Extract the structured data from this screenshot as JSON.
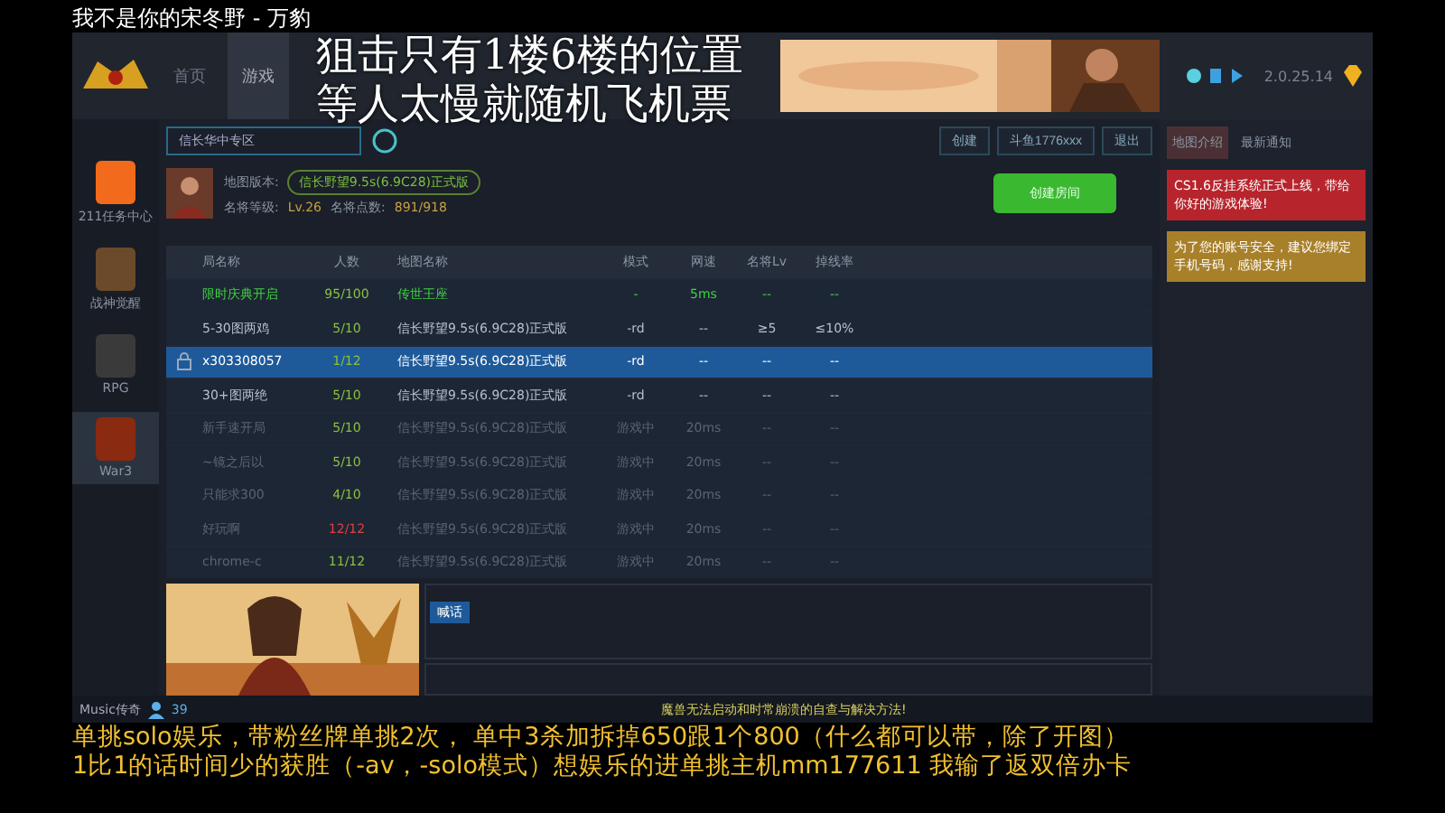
{
  "stream_title": "我不是你的宋冬野 - 万豹",
  "overlay_text": [
    "狙击只有1楼6楼的位置",
    "等人太慢就随机飞机票"
  ],
  "header": {
    "nav": [
      {
        "label": "首页",
        "selected": false
      },
      {
        "label": "游戏",
        "selected": true
      }
    ],
    "version": "2.0.25.14"
  },
  "sidebar": {
    "items": [
      {
        "label": "211任务中心",
        "selected": false
      },
      {
        "label": "战神觉醒",
        "selected": false
      },
      {
        "label": "RPG",
        "selected": false
      },
      {
        "label": "War3",
        "selected": true
      }
    ]
  },
  "lobby": {
    "zone": "信长华中专区",
    "map_label": "地图版本:",
    "map_value": "信长野望9.5s(6.9C28)正式版",
    "level_label": "名将等级:",
    "level": "Lv.26",
    "points_label": "名将点数:",
    "points": "891/918",
    "top_buttons": [
      "创建",
      "斗鱼1776xxx",
      "退出"
    ],
    "create_button": "创建房间"
  },
  "table": {
    "columns": [
      "局名称",
      "人数",
      "地图名称",
      "模式",
      "网速",
      "名将Lv",
      "掉线率"
    ],
    "rows": [
      {
        "kind": "event",
        "locked": false,
        "selected": false,
        "full": false,
        "cells": [
          "限时庆典开启",
          "95/100",
          "传世王座",
          "-",
          "5ms",
          "--",
          "--"
        ]
      },
      {
        "kind": "open",
        "locked": false,
        "selected": false,
        "full": false,
        "cells": [
          "5-30图两鸡",
          "5/10",
          "信长野望9.5s(6.9C28)正式版",
          "-rd",
          "--",
          "≥5",
          "≤10%"
        ]
      },
      {
        "kind": "open",
        "locked": true,
        "selected": true,
        "full": false,
        "cells": [
          "x303308057",
          "1/12",
          "信长野望9.5s(6.9C28)正式版",
          "-rd",
          "--",
          "--",
          "--"
        ]
      },
      {
        "kind": "open",
        "locked": false,
        "selected": false,
        "full": false,
        "cells": [
          "30+图两绝",
          "5/10",
          "信长野望9.5s(6.9C28)正式版",
          "-rd",
          "--",
          "--",
          "--"
        ]
      },
      {
        "kind": "playing",
        "locked": false,
        "selected": false,
        "full": false,
        "cells": [
          "新手速开局",
          "5/10",
          "信长野望9.5s(6.9C28)正式版",
          "游戏中",
          "20ms",
          "--",
          "--"
        ]
      },
      {
        "kind": "playing",
        "locked": false,
        "selected": false,
        "full": false,
        "cells": [
          "~镜之后以",
          "5/10",
          "信长野望9.5s(6.9C28)正式版",
          "游戏中",
          "20ms",
          "--",
          "--"
        ]
      },
      {
        "kind": "playing",
        "locked": false,
        "selected": false,
        "full": false,
        "cells": [
          "只能求300",
          "4/10",
          "信长野望9.5s(6.9C28)正式版",
          "游戏中",
          "20ms",
          "--",
          "--"
        ]
      },
      {
        "kind": "playing",
        "locked": false,
        "selected": false,
        "full": true,
        "cells": [
          "好玩啊",
          "12/12",
          "信长野望9.5s(6.9C28)正式版",
          "游戏中",
          "20ms",
          "--",
          "--"
        ]
      },
      {
        "kind": "playing",
        "locked": false,
        "selected": false,
        "full": false,
        "cells": [
          "chrome-c",
          "11/12",
          "信长野望9.5s(6.9C28)正式版",
          "游戏中",
          "20ms",
          "--",
          "--"
        ]
      }
    ]
  },
  "chat": {
    "tab": "喊话"
  },
  "right_panel": {
    "tabs": [
      {
        "label": "地图介绍",
        "selected": true
      },
      {
        "label": "最新通知",
        "selected": false
      }
    ],
    "notices": [
      {
        "color": "#b8242c",
        "text": "CS1.6反挂系统正式上线，带给你好的游戏体验!"
      },
      {
        "color": "#a8802a",
        "text": "为了您的账号安全，建议您绑定手机号码，感谢支持!"
      }
    ]
  },
  "status_bar": {
    "user": "Music传奇",
    "online": "39",
    "notice": "魔兽无法启动和时常崩溃的自查与解决方法!"
  },
  "subtitles": [
    "单挑solo娱乐，带粉丝牌单挑2次，  单中3杀加拆掉650跟1个800（什么都可以带，除了开图）",
    "1比1的话时间少的获胜（-av，-solo模式）想娱乐的进单挑主机mm177611 我输了返双倍办卡"
  ]
}
